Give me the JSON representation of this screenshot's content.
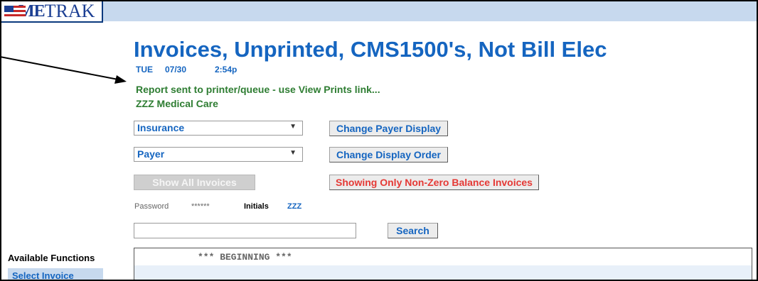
{
  "app": {
    "logo_me": "ME",
    "logo_trak": "TRAK",
    "logo_flag_colors": [
      "#c62828",
      "#ffffff",
      "#1c3f93"
    ]
  },
  "report": {
    "title": "Invoices, Unprinted, CMS1500's, Not Bill Elec",
    "day": "TUE",
    "date": "07/30",
    "time": "2:54p",
    "message": "Report sent to printer/queue - use View Prints link...",
    "practice": "ZZZ Medical Care"
  },
  "controls": {
    "payer_type_select": "Insurance",
    "change_payer_display_label": "Change Payer Display",
    "display_order_select": "Payer",
    "change_display_order_label": "Change Display Order",
    "show_all_label": "Show All Invoices",
    "non_zero_label": "Showing Only Non-Zero Balance Invoices",
    "password_label": "Password",
    "password_value": "******",
    "initials_label": "Initials",
    "initials_value": "ZZZ",
    "search_value": "",
    "search_label": "Search"
  },
  "sidebar": {
    "heading": "Available Functions",
    "items": [
      {
        "label": "Select Invoice"
      }
    ]
  },
  "list": {
    "header_text": "*** BEGINNING ***"
  },
  "colors": {
    "title_blue": "#1565c0",
    "message_green": "#2e7d32",
    "alert_red": "#e53935",
    "bar_blue": "#c7d9ee"
  }
}
